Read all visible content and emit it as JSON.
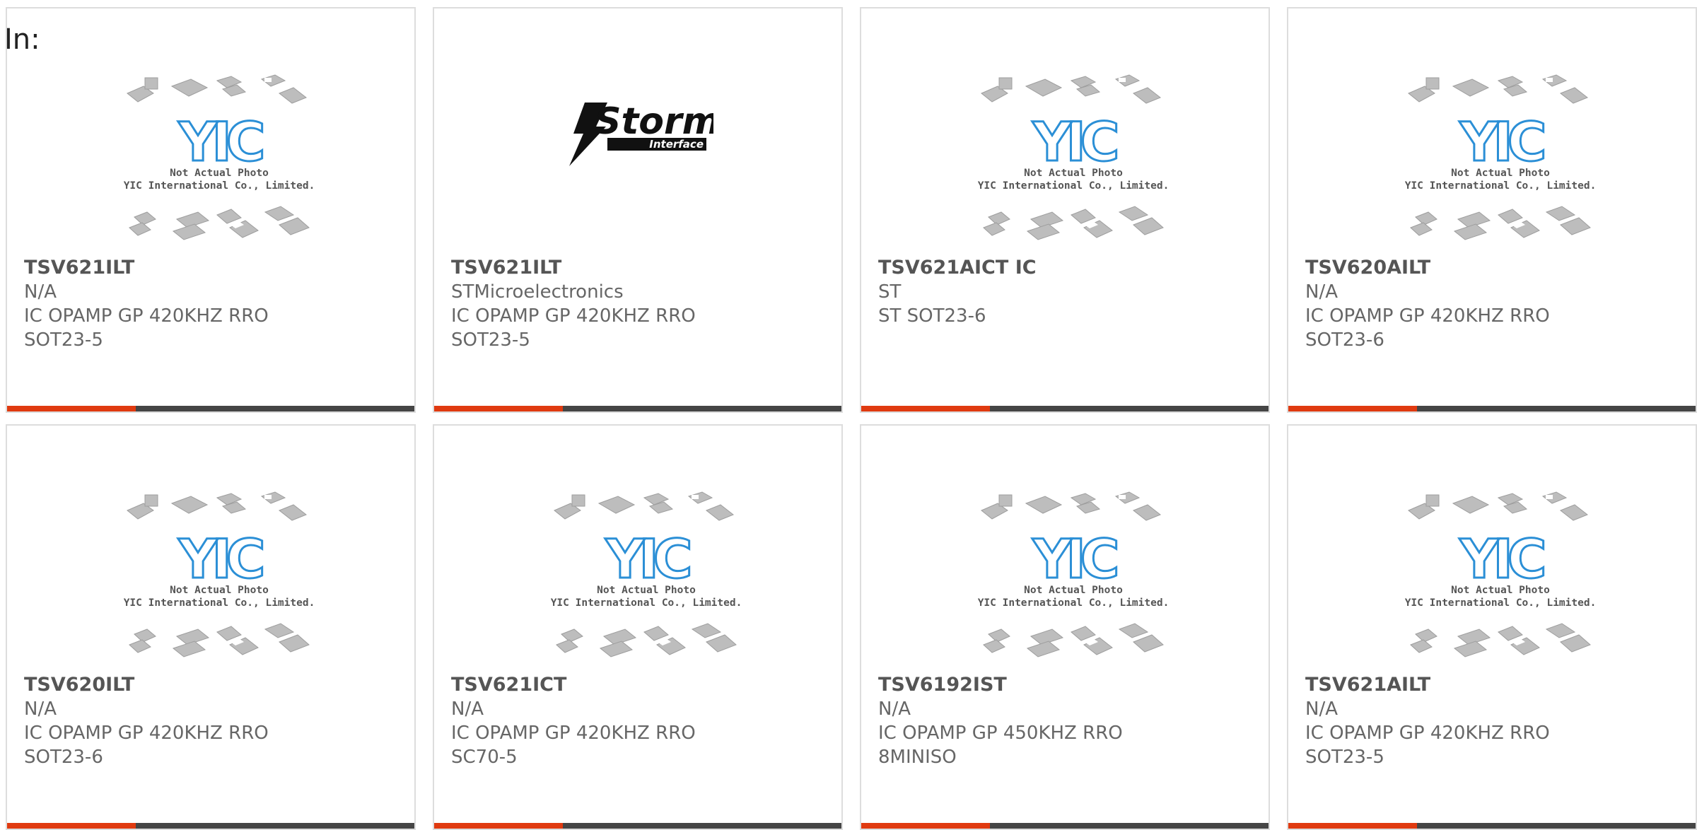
{
  "page": {
    "in_label": "In:",
    "placeholder_caption": [
      "Not Actual Photo",
      "YIC International Co., Limited."
    ],
    "logo_text": "YIC",
    "storm_logo_text": "Storm",
    "storm_logo_sub": "Interface",
    "accent_color": "#e03a10",
    "bar_color": "#454545"
  },
  "products": [
    {
      "part": "TSV621ILT",
      "manufacturer": "N/A",
      "description": "IC OPAMP GP 420KHZ RRO SOT23-5",
      "image": "yic-placeholder"
    },
    {
      "part": "TSV621ILT",
      "manufacturer": "STMicroelectronics",
      "description": "IC OPAMP GP 420KHZ RRO SOT23-5",
      "image": "storm-interface-logo"
    },
    {
      "part": "TSV621AICT IC",
      "manufacturer": "ST",
      "description": "ST SOT23-6",
      "image": "yic-placeholder"
    },
    {
      "part": "TSV620AILT",
      "manufacturer": "N/A",
      "description": "IC OPAMP GP 420KHZ RRO SOT23-6",
      "image": "yic-placeholder"
    },
    {
      "part": "TSV620ILT",
      "manufacturer": "N/A",
      "description": "IC OPAMP GP 420KHZ RRO SOT23-6",
      "image": "yic-placeholder"
    },
    {
      "part": "TSV621ICT",
      "manufacturer": "N/A",
      "description": "IC OPAMP GP 420KHZ RRO SC70-5",
      "image": "yic-placeholder"
    },
    {
      "part": "TSV6192IST",
      "manufacturer": "N/A",
      "description": "IC OPAMP GP 450KHZ RRO 8MINISO",
      "image": "yic-placeholder"
    },
    {
      "part": "TSV621AILT",
      "manufacturer": "N/A",
      "description": "IC OPAMP GP 420KHZ RRO SOT23-5",
      "image": "yic-placeholder"
    }
  ]
}
